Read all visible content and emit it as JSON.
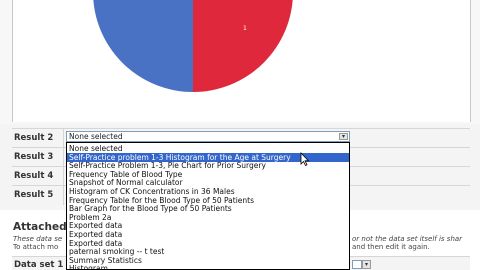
{
  "chart_data": {
    "type": "pie",
    "slice_labels": [
      "1"
    ],
    "colors": [
      "#4a72c4",
      "#e0283c"
    ]
  },
  "results": {
    "rows": [
      {
        "label": "Result 2"
      },
      {
        "label": "Result 3"
      },
      {
        "label": "Result 4"
      },
      {
        "label": "Result 5"
      }
    ],
    "select_value": "None selected",
    "dropdown_arrow": "▾",
    "dropdown_items": [
      "None selected",
      "Self-Practice problem 1-3 Histogram for the Age at Surgery",
      "Self-Practice Problem 1-3, Pie Chart for Prior Surgery",
      "Frequency Table of Blood Type",
      "Snapshot of Normal calculator",
      "Histogram of CK Concentrations in 36 Males",
      "Frequency Table for the Blood Type of 50 Patients",
      "Bar Graph for the Blood Type of 50 Patients",
      "Problem 2a",
      "Exported data",
      "Exported data",
      "Exported data",
      "paternal smoking -- t test",
      "Summary Statistics",
      "Histogram"
    ],
    "selected_index": 1
  },
  "attached": {
    "title_visible": "Attached d",
    "desc_line1": "These data se",
    "desc_line2": "To attach mo",
    "desc_right1": "or not the data set itself is shar",
    "desc_right2": "and then edit it again.",
    "dataset_label": "Data set 1",
    "dataset_arrow": "▾"
  },
  "colors": {
    "selection": "#3366cc",
    "pie_blue": "#4a72c4",
    "pie_red": "#e0283c"
  }
}
